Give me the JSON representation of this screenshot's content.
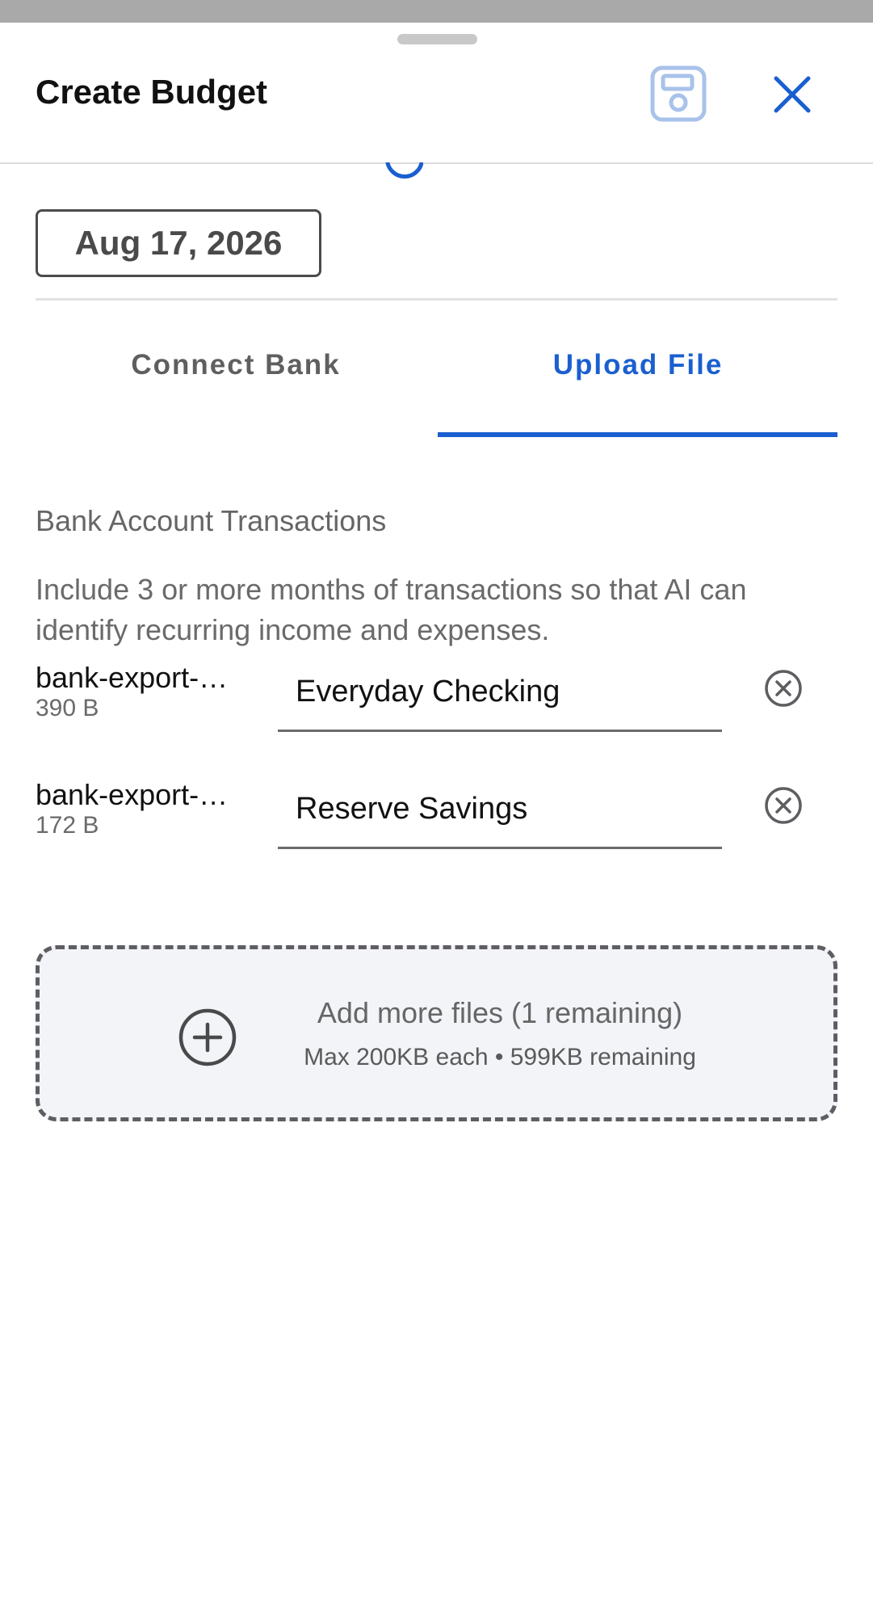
{
  "header": {
    "title": "Create Budget",
    "save_icon": "save-floppy-icon",
    "close_icon": "close-icon"
  },
  "date_field": {
    "value": "Aug 17, 2026"
  },
  "tabs": [
    {
      "label": "Connect Bank",
      "active": false
    },
    {
      "label": "Upload File",
      "active": true
    }
  ],
  "section": {
    "label": "Bank Account Transactions",
    "help": "Include 3 or more months of transactions so that AI can identify recurring income and expenses."
  },
  "files": [
    {
      "name": "bank-export-…",
      "size": "390 B",
      "account_name": "Everyday Checking"
    },
    {
      "name": "bank-export-…",
      "size": "172 B",
      "account_name": "Reserve Savings"
    }
  ],
  "dropzone": {
    "title": "Add more files (1 remaining)",
    "subtitle": "Max 200KB each • 599KB remaining"
  },
  "colors": {
    "accent": "#1a5fd0",
    "save_icon": "#a8c2ea",
    "dropzone_bg": "#f3f4f8"
  }
}
